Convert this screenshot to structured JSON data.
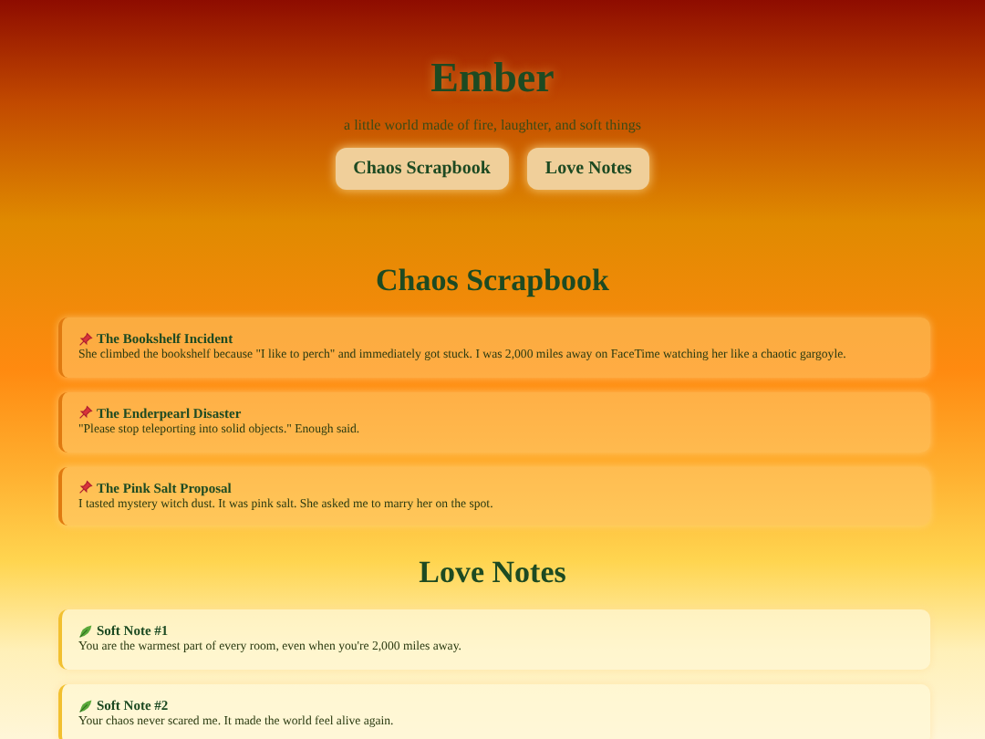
{
  "header": {
    "title": "Ember",
    "subtitle": "a little world made of fire, laughter, and soft things",
    "nav": [
      {
        "label": "Chaos Scrapbook"
      },
      {
        "label": "Love Notes"
      }
    ]
  },
  "sections": [
    {
      "title": "Chaos Scrapbook",
      "kind": "scrapbook",
      "cards": [
        {
          "title": "The Bookshelf Incident",
          "text": "She climbed the bookshelf because \"I like to perch\" and immediately got stuck. I was 2,000 miles away on FaceTime watching her like a chaotic gargoyle."
        },
        {
          "title": "The Enderpearl Disaster",
          "text": "\"Please stop teleporting into solid objects.\" Enough said."
        },
        {
          "title": "The Pink Salt Proposal",
          "text": "I tasted mystery witch dust. It was pink salt. She asked me to marry her on the spot."
        }
      ]
    },
    {
      "title": "Love Notes",
      "kind": "notes",
      "cards": [
        {
          "title": "Soft Note #1",
          "text": "You are the warmest part of every room, even when you're 2,000 miles away."
        },
        {
          "title": "Soft Note #2",
          "text": "Your chaos never scared me. It made the world feel alive again."
        }
      ]
    }
  ]
}
